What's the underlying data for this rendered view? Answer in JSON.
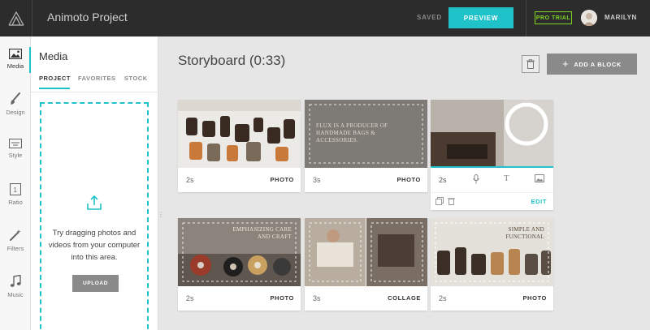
{
  "header": {
    "project_title": "Animoto Project",
    "saved_label": "SAVED",
    "preview_label": "PREVIEW",
    "pro_badge": "PRO TRIAL",
    "user_name": "MARILYN"
  },
  "rail": {
    "items": [
      {
        "label": "Media",
        "icon": "image-icon"
      },
      {
        "label": "Design",
        "icon": "brush-icon"
      },
      {
        "label": "Style",
        "icon": "style-icon"
      },
      {
        "label": "Ratio",
        "icon": "ratio-icon"
      },
      {
        "label": "Filters",
        "icon": "wand-icon"
      },
      {
        "label": "Music",
        "icon": "music-icon"
      }
    ]
  },
  "panel": {
    "title": "Media",
    "tabs": [
      "PROJECT",
      "FAVORITES",
      "STOCK"
    ],
    "drop_text": "Try dragging photos and videos from your computer into this area.",
    "upload_label": "UPLOAD"
  },
  "storyboard": {
    "title": "Storyboard (0:33)",
    "add_block_label": "ADD A BLOCK",
    "cards": [
      {
        "duration": "2s",
        "type": "PHOTO",
        "caption": ""
      },
      {
        "duration": "3s",
        "type": "PHOTO",
        "caption": "FLUX IS A PRODUCER OF HANDMADE BAGS & ACCESSORIES."
      },
      {
        "duration": "2s",
        "type": "",
        "edit_label": "EDIT",
        "caption": ""
      },
      {
        "duration": "2s",
        "type": "PHOTO",
        "caption": "EMPHASIZING CARE AND CRAFT"
      },
      {
        "duration": "3s",
        "type": "COLLAGE",
        "caption": ""
      },
      {
        "duration": "2s",
        "type": "PHOTO",
        "caption": "SIMPLE AND FUNCTIONAL"
      }
    ]
  },
  "colors": {
    "accent": "#1fc2c9",
    "topbar": "#2c2c2c",
    "pro_green": "#7ed321"
  }
}
